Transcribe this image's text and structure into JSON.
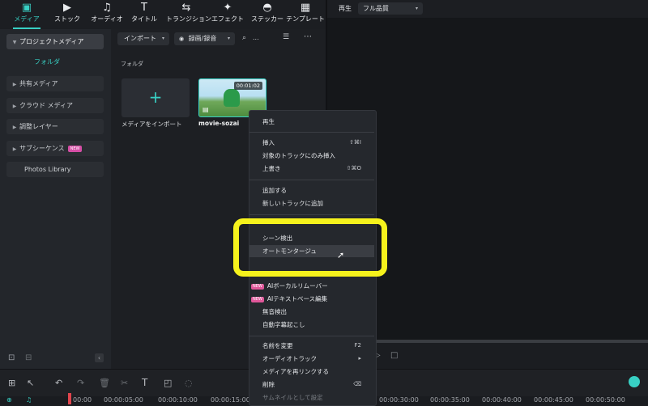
{
  "toolbar": {
    "tabs": [
      {
        "label": "メディア",
        "icon": "media-icon"
      },
      {
        "label": "ストック",
        "icon": "stock-icon"
      },
      {
        "label": "オーディオ",
        "icon": "music-icon"
      },
      {
        "label": "タイトル",
        "icon": "title-icon"
      },
      {
        "label": "トランジション",
        "icon": "transition-icon"
      },
      {
        "label": "エフェクト",
        "icon": "effect-icon"
      },
      {
        "label": "ステッカー",
        "icon": "sticker-icon"
      },
      {
        "label": "テンプレート",
        "icon": "template-icon"
      }
    ],
    "active_color": "#38d0c4"
  },
  "sidebar": {
    "items": [
      {
        "label": "プロジェクトメディア"
      },
      {
        "label": "フォルダ"
      },
      {
        "label": "共有メディア"
      },
      {
        "label": "クラウド メディア"
      },
      {
        "label": "調整レイヤー"
      },
      {
        "label": "サブシーケンス",
        "badge": "NEW"
      },
      {
        "label": "Photos Library"
      }
    ]
  },
  "media": {
    "import_label": "インポート",
    "record_label": "録画/録音",
    "search_placeholder": "...",
    "folder_label": "フォルダ",
    "import_tile_label": "メディアをインポート",
    "clip_name": "movie-sozai",
    "clip_duration": "00:01:02"
  },
  "preview": {
    "label": "再生",
    "quality": "フル品質"
  },
  "timeline": {
    "ruler": [
      "00:00",
      "00:00:05:00",
      "00:00:10:00",
      "00:00:15:00",
      "00:00:30:00",
      "00:00:35:00",
      "00:00:40:00",
      "00:00:45:00",
      "00:00:50:00"
    ]
  },
  "context_menu": {
    "items": [
      {
        "label": "再生",
        "shortcut": ""
      },
      {
        "label": "挿入",
        "shortcut": "⇧⌘I"
      },
      {
        "label": "対象のトラックにのみ挿入",
        "shortcut": ""
      },
      {
        "label": "上書き",
        "shortcut": "⇧⌘O"
      },
      {
        "label": "追加する",
        "shortcut": ""
      },
      {
        "label": "新しいトラックに追加",
        "shortcut": ""
      },
      {
        "label": "シーン検出",
        "shortcut": ""
      },
      {
        "label": "オートモンタージュ",
        "shortcut": ""
      },
      {
        "label": "AIボーカルリムーバー",
        "shortcut": "",
        "badge": "NEW"
      },
      {
        "label": "AIテキストベース編集",
        "shortcut": "",
        "badge": "NEW"
      },
      {
        "label": "無音検出",
        "shortcut": ""
      },
      {
        "label": "自動字幕起こし",
        "shortcut": ""
      },
      {
        "label": "名前を変更",
        "shortcut": "F2"
      },
      {
        "label": "オーディオトラック",
        "shortcut": "▸"
      },
      {
        "label": "メディアを再リンクする",
        "shortcut": ""
      },
      {
        "label": "削除",
        "shortcut": "⌫"
      },
      {
        "label": "サムネイルとして設定",
        "shortcut": ""
      }
    ]
  },
  "highlight_color": "#f6f21c"
}
